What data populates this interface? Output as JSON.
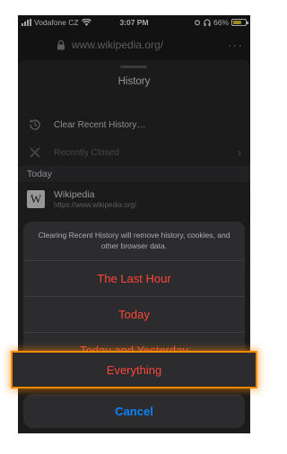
{
  "status_bar": {
    "carrier": "Vodafone CZ",
    "time": "3:07 PM",
    "battery": "66%",
    "battery_level": 0.66
  },
  "url_bar": {
    "url": "www.wikipedia.org/",
    "more": "···"
  },
  "history_sheet": {
    "title": "History",
    "clear_recent": "Clear Recent History…",
    "recently_closed": "Recently Closed",
    "section_today": "Today",
    "site_title": "Wikipedia",
    "site_url": "https://www.wikipedia.org/"
  },
  "action_sheet": {
    "message": "Clearing Recent History will remove history, cookies, and other browser data.",
    "options": [
      "The Last Hour",
      "Today",
      "Today and Yesterday"
    ],
    "everything": "Everything",
    "cancel": "Cancel"
  },
  "colors": {
    "destructive": "#ff453a",
    "cancel": "#0a84ff",
    "highlight": "#ff8a00"
  }
}
